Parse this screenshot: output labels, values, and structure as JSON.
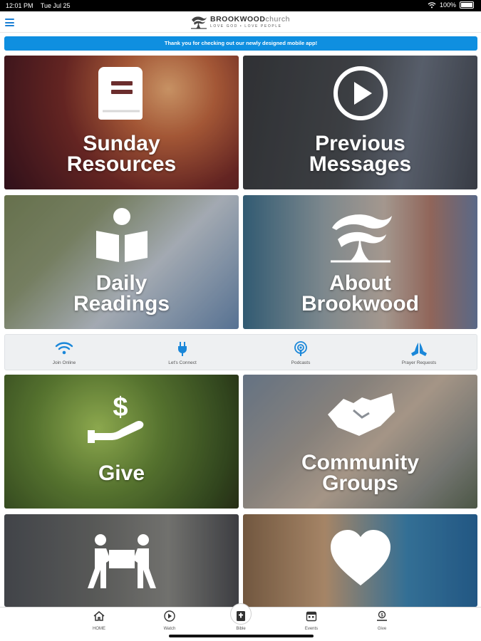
{
  "status_bar": {
    "time": "12:01 PM",
    "date": "Tue Jul 25",
    "battery": "100%"
  },
  "header": {
    "logo_main": "BROOKWOOD",
    "logo_sub": "church",
    "logo_tagline": "LOVE GOD • LOVE PEOPLE"
  },
  "banner": {
    "text": "Thank you for checking out our newly designed mobile app!"
  },
  "tiles": {
    "sunday": {
      "line1": "Sunday",
      "line2": "Resources",
      "icon": "book-icon"
    },
    "previous": {
      "line1": "Previous",
      "line2": "Messages",
      "icon": "play-circle-icon"
    },
    "daily": {
      "line1": "Daily",
      "line2": "Readings",
      "icon": "reader-icon"
    },
    "about": {
      "line1": "About",
      "line2": "Brookwood",
      "icon": "brookwood-tree-icon"
    },
    "give": {
      "line1": "Give",
      "icon": "hand-dollar-icon"
    },
    "community": {
      "line1": "Community",
      "line2": "Groups",
      "icon": "handshake-icon"
    },
    "serve": {
      "icon": "carry-box-icon"
    },
    "care": {
      "icon": "heart-icon"
    }
  },
  "quick_links": [
    {
      "label": "Join Online",
      "icon": "wifi-icon"
    },
    {
      "label": "Let's Connect",
      "icon": "plug-icon"
    },
    {
      "label": "Podcasts",
      "icon": "podcast-icon"
    },
    {
      "label": "Prayer Requests",
      "icon": "praying-hands-icon"
    }
  ],
  "tabs": [
    {
      "label": "HOME",
      "icon": "home-icon"
    },
    {
      "label": "Watch",
      "icon": "play-icon"
    },
    {
      "label": "Bible",
      "icon": "bible-icon"
    },
    {
      "label": "Events",
      "icon": "calendar-icon"
    },
    {
      "label": "Give",
      "icon": "give-icon"
    }
  ],
  "colors": {
    "accent": "#0f8fe0",
    "menu": "#1a7fd4",
    "quick_icon": "#1a87d9"
  }
}
